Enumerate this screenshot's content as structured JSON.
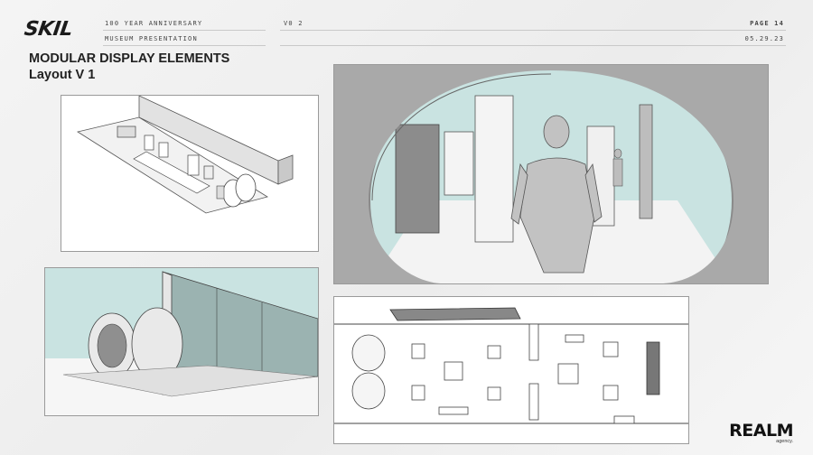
{
  "header": {
    "brand": "SKIL",
    "line1": "100 YEAR ANNIVERSARY",
    "line2": "MUSEUM PRESENTATION",
    "version": "V0 2",
    "page": "PAGE 14",
    "date": "05.29.23"
  },
  "title": {
    "main": "MODULAR DISPLAY ELEMENTS",
    "sub": "Layout V 1"
  },
  "footer": {
    "agency": "REALM",
    "agency_sub": "agency."
  },
  "colors": {
    "accent_sky": "#c9e3e1",
    "panel_border": "#9a9a9a",
    "model_gray": "#bdbdbd"
  }
}
